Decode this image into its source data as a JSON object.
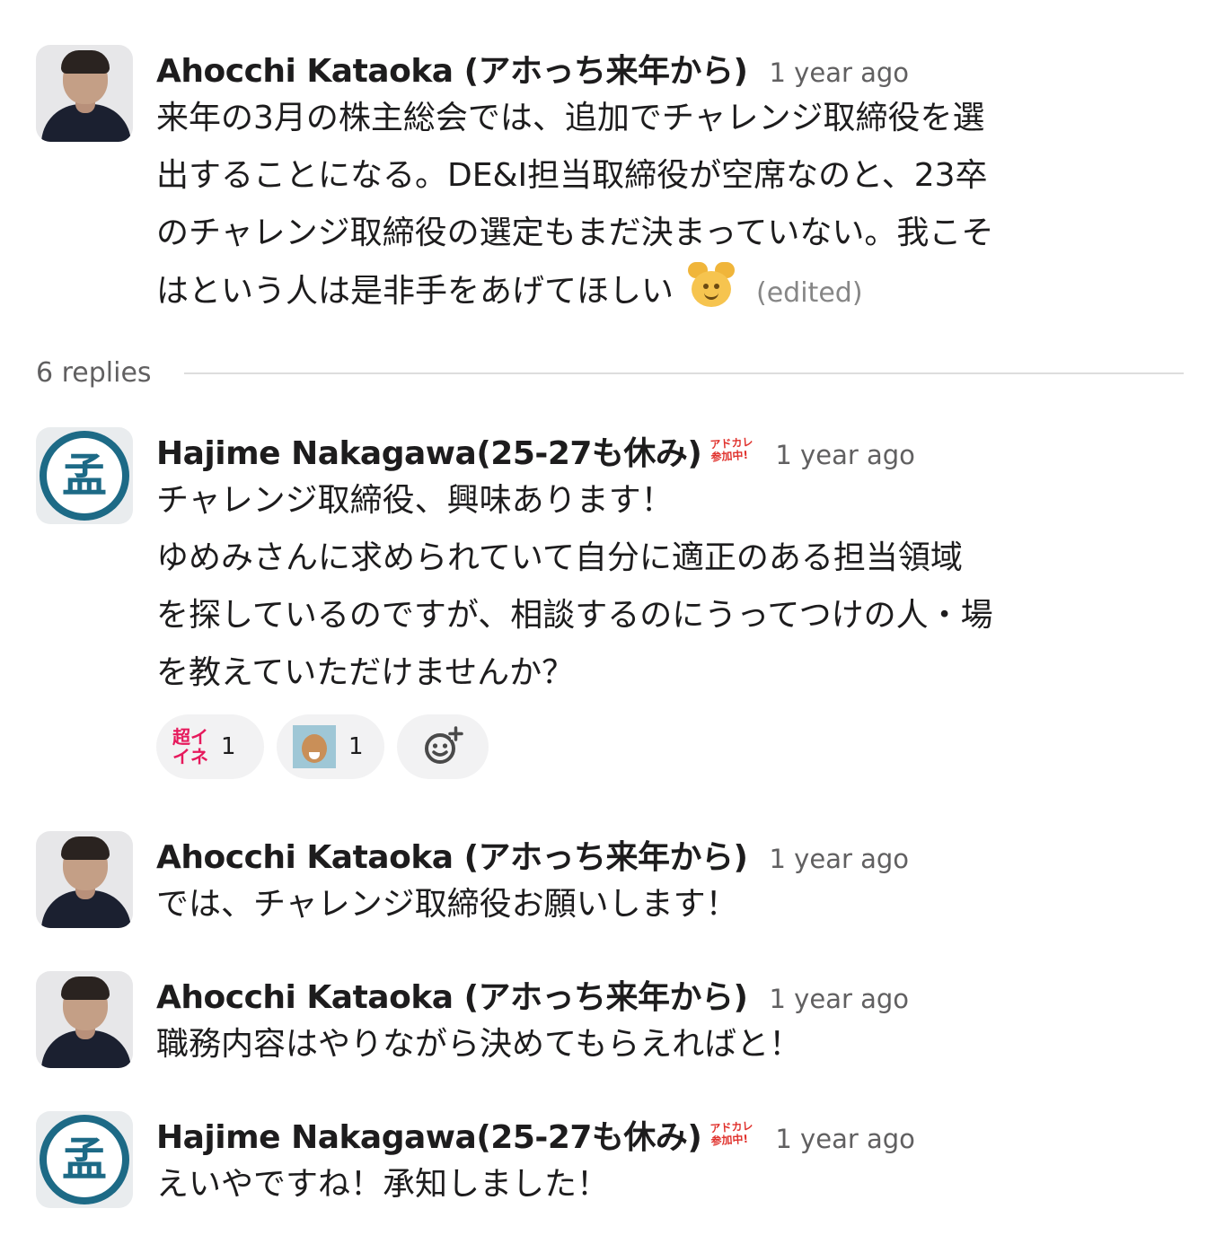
{
  "thread": {
    "parent": {
      "author": "Ahocchi Kataoka (アホっち来年から)",
      "timestamp": "1 year ago",
      "lines": [
        "来年の3月の株主総会では、追加でチャレンジ取締役を選",
        "出することになる。DE&I担当取締役が空席なのと、23卒",
        "のチャレンジ取締役の選定もまだ決まっていない。我こそ",
        "はという人は是非手をあげてほしい"
      ],
      "emoji": "pray-smile-emoji",
      "edited": "(edited)"
    },
    "replies_label": "6 replies",
    "replies": [
      {
        "author": "Hajime Nakagawa(25-27も休み)",
        "badge": [
          "アドカレ",
          "参加中!"
        ],
        "timestamp": "1 year ago",
        "lines": [
          "チャレンジ取締役、興味あります！",
          "ゆめみさんに求められていて自分に適正のある担当領域",
          "を探しているのですが、相談するのにうってつけの人・場",
          "を教えていただけませんか？"
        ],
        "reactions": [
          {
            "emoji": "chou-iine-emoji",
            "emoji_text": [
              "超イ",
              "イネ"
            ],
            "count": "1"
          },
          {
            "emoji": "person-face-emoji",
            "count": "1"
          }
        ]
      },
      {
        "author": "Ahocchi Kataoka (アホっち来年から)",
        "timestamp": "1 year ago",
        "lines": [
          "では、チャレンジ取締役お願いします！"
        ]
      },
      {
        "author": "Ahocchi Kataoka (アホっち来年から)",
        "timestamp": "1 year ago",
        "lines": [
          "職務内容はやりながら決めてもらえればと！"
        ]
      },
      {
        "author": "Hajime Nakagawa(25-27も休み)",
        "badge": [
          "アドカレ",
          "参加中!"
        ],
        "timestamp": "1 year ago",
        "lines": [
          "えいやですね！承知しました！"
        ]
      }
    ]
  },
  "avatar_logo_char": "孟",
  "colors": {
    "text": "#1d1c1d",
    "muted": "#616061",
    "reaction_bg": "#f2f2f3",
    "logo": "#1d6a86"
  }
}
